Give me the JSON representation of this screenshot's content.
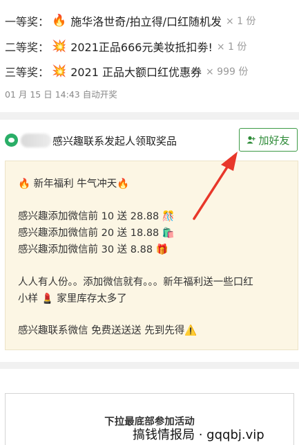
{
  "prizes": [
    {
      "rank": "一等奖：",
      "icon": "fire-emoji",
      "emoji": "🔥",
      "name": "施华洛世奇/拍立得/口红随机发",
      "qty": "× 1 份"
    },
    {
      "rank": "二等奖：",
      "icon": "collision-emoji",
      "emoji": "💥",
      "name": "2021正品666元美妆抵扣劵!",
      "qty": "× 1 份"
    },
    {
      "rank": "三等奖：",
      "icon": "collision-emoji",
      "emoji": "💥",
      "name": "2021 正品大额口红优惠券",
      "qty": "× 999 份"
    }
  ],
  "auto_open": "01 月 15 日 14:43 自动开奖",
  "sponsor": {
    "title": "感兴趣联系发起人领取奖品",
    "add_friend_label": "加好友",
    "accent_color": "#2e8b38"
  },
  "notice": {
    "lines": [
      "🔥 新年福利 牛气冲天🔥",
      "感兴趣添加微信前 10 送 28.88 🎊",
      "感兴趣添加微信前 20 送 18.88 🛍️",
      "感兴趣添加微信前 30 送 8.88 🎁",
      "人人有人份。。添加微信就有。。。新年福利送一些口红",
      "小样 💄 家里库存太多了",
      "感兴趣联系微信 免费送送送 先到先得⚠️"
    ]
  },
  "bottom": {
    "title": "下拉最底部参加活动"
  },
  "watermark": "搞钱情报局 · gqqbj.vip"
}
